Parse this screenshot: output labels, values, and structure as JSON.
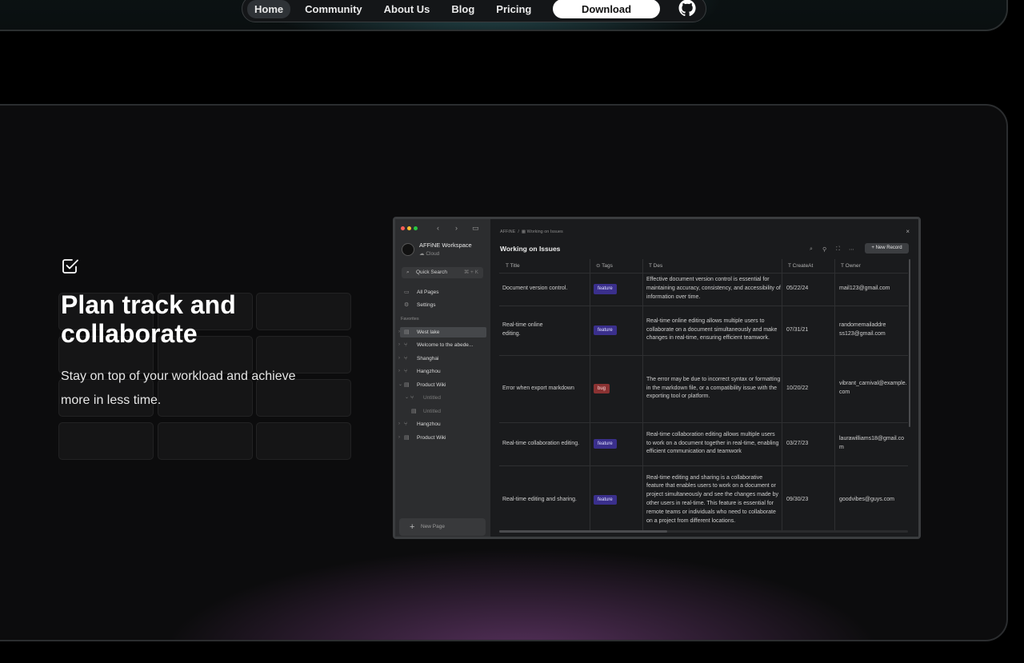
{
  "nav": {
    "items": [
      {
        "label": "Home",
        "active": true
      },
      {
        "label": "Community",
        "active": false
      },
      {
        "label": "About Us",
        "active": false
      },
      {
        "label": "Blog",
        "active": false
      },
      {
        "label": "Pricing",
        "active": false
      }
    ],
    "download_label": "Download",
    "github_icon": "github-icon"
  },
  "hero": {
    "headline": "Plan track and collaborate",
    "subline": "Stay on top of your workload and achieve more in less time.",
    "icon": "checkbox-icon"
  },
  "app": {
    "workspace_name": "AFFiNE Workspace",
    "workspace_sub": "Cloud",
    "quick_search": "Quick Search",
    "quick_search_key": "⌘ + K",
    "menu": [
      {
        "label": "All Pages",
        "icon": "folder-icon"
      },
      {
        "label": "Settings",
        "icon": "gear-icon"
      }
    ],
    "favorites_label": "Favorites",
    "favorites": [
      {
        "label": "West lake",
        "selected": true,
        "dim": false,
        "indent": 0
      },
      {
        "label": "Welcome to the abede...",
        "selected": false,
        "dim": false,
        "indent": 0
      },
      {
        "label": "Shanghai",
        "selected": false,
        "dim": false,
        "indent": 0
      },
      {
        "label": "Hangzhou",
        "selected": false,
        "dim": false,
        "indent": 0
      },
      {
        "label": "Product Wiki",
        "selected": false,
        "dim": false,
        "indent": 0
      },
      {
        "label": "Untitled",
        "selected": false,
        "dim": true,
        "indent": 1
      },
      {
        "label": "Untitled",
        "selected": false,
        "dim": true,
        "indent": 2
      },
      {
        "label": "Hangzhou",
        "selected": false,
        "dim": false,
        "indent": 0
      },
      {
        "label": "Product Wiki",
        "selected": false,
        "dim": false,
        "indent": 0
      }
    ],
    "new_page": "New Page",
    "breadcrumb_root": "AFFiNE",
    "breadcrumb_sep": "/",
    "breadcrumb_page": "Working on Issues",
    "title": "Working on Issues",
    "new_record": "New Record",
    "columns": [
      "Title",
      "Tags",
      "Des",
      "CreateAt",
      "Owner"
    ],
    "rows": [
      {
        "title": "Document version control.",
        "tag": "feature",
        "tag_type": "feature",
        "des": "Effective document version control is essential for maintaining accuracy, consistency, and accessibility of information over time.",
        "date": "05/22/24",
        "owner": "mail123@gmail.com"
      },
      {
        "title": "Real-time online editing.",
        "tag": "feature",
        "tag_type": "feature",
        "des": "Real-time online editing allows multiple users to collaborate on a document simultaneously and make changes in real-time, ensuring efficient teamwork.",
        "date": "07/31/21",
        "owner": "randomemailaddress123@gmail.com"
      },
      {
        "title": "Error when export markdown",
        "tag": "bug",
        "tag_type": "bug",
        "des": "The error may be due to incorrect syntax or formatting in the markdown file, or a compatibility issue with the exporting tool or platform.",
        "date": "10/20/22",
        "owner": "vibrant_carnival@example.com"
      },
      {
        "title": "Real-time collaboration editing.",
        "tag": "feature",
        "tag_type": "feature",
        "des": "Real-time collaboration editing allows multiple users to work on a document together in real-time, enabling efficient communication and teamwork",
        "date": "03/27/23",
        "owner": "laurawilliams18@gmail.com"
      },
      {
        "title": "Real-time editing and sharing.",
        "tag": "feature",
        "tag_type": "feature",
        "des": "Real-time editing and sharing is a collaborative feature that enables users to work on a document or project simultaneously and see the changes made by other users in real-time. This feature is essential for remote teams or individuals who need to collaborate on a project from different locations.",
        "date": "09/30/23",
        "owner": "goodvibes@guys.com"
      }
    ]
  },
  "colors": {
    "tag_feature": "#3a2f8c",
    "tag_bug": "#8a3232",
    "traffic_red": "#ff5f57",
    "traffic_yellow": "#febc2e",
    "traffic_green": "#28c840"
  }
}
